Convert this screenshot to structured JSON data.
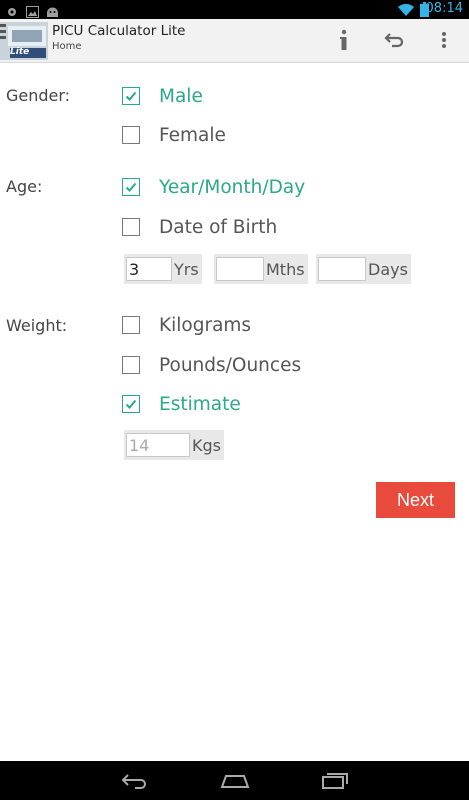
{
  "status_bar": {
    "time": "08:14",
    "icons": [
      "notification-icon",
      "image-icon",
      "android-icon",
      "wifi-icon",
      "battery-icon"
    ]
  },
  "action_bar": {
    "title": "PICU Calculator Lite",
    "subtitle": "Home",
    "app_icon_text": "Lite",
    "actions": [
      "info-icon",
      "undo-icon",
      "overflow-menu-icon"
    ]
  },
  "form": {
    "gender": {
      "label": "Gender:",
      "options": [
        {
          "label": "Male",
          "checked": true
        },
        {
          "label": "Female",
          "checked": false
        }
      ]
    },
    "age": {
      "label": "Age:",
      "options": [
        {
          "label": "Year/Month/Day",
          "checked": true
        },
        {
          "label": "Date of Birth",
          "checked": false
        }
      ],
      "fields": [
        {
          "value": "3",
          "placeholder": "",
          "unit": "Yrs"
        },
        {
          "value": "",
          "placeholder": "",
          "unit": "Mths"
        },
        {
          "value": "",
          "placeholder": "",
          "unit": "Days"
        }
      ]
    },
    "weight": {
      "label": "Weight:",
      "options": [
        {
          "label": "Kilograms",
          "checked": false
        },
        {
          "label": "Pounds/Ounces",
          "checked": false
        },
        {
          "label": "Estimate",
          "checked": true
        }
      ],
      "field": {
        "value": "",
        "placeholder": "14",
        "unit": "Kgs"
      }
    },
    "next_label": "Next"
  },
  "colors": {
    "accent": "#2aa88b",
    "next_button": "#e84a3c",
    "status_blue": "#33b5e5"
  }
}
